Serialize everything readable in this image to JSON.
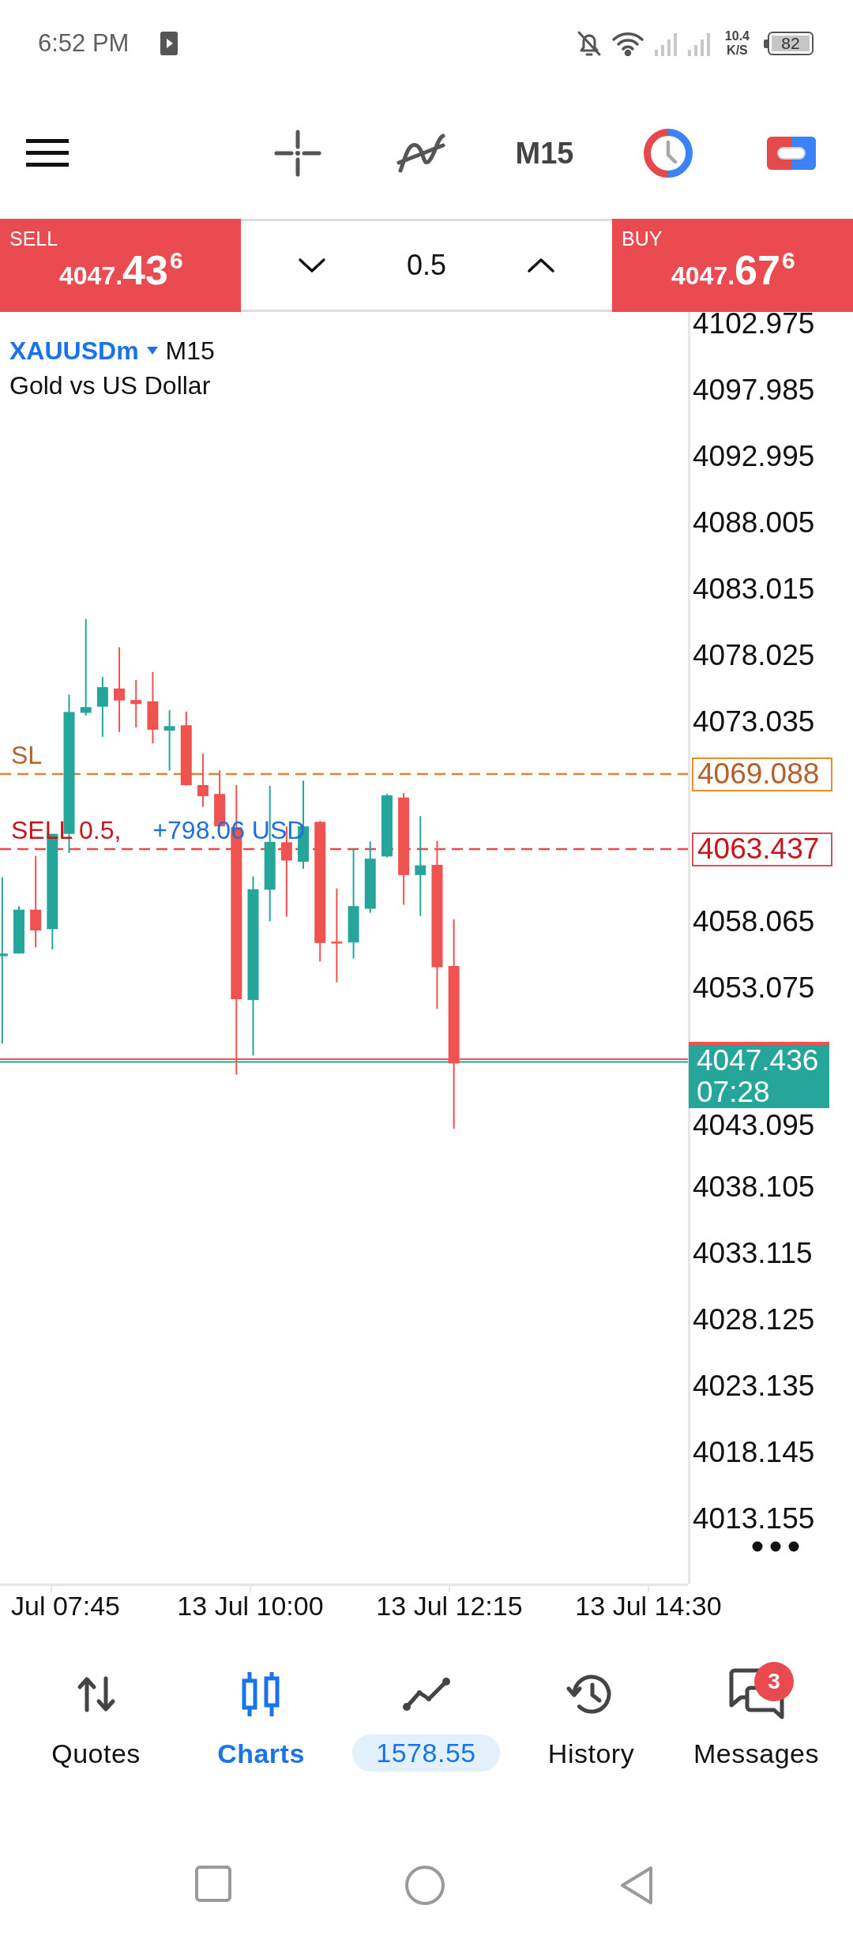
{
  "status_bar": {
    "time": "6:52 PM",
    "net_speed": "10.4",
    "net_speed_unit": "K/S",
    "battery": "82"
  },
  "toolbar": {
    "timeframe": "M15"
  },
  "trade_panel": {
    "sell": {
      "label": "SELL",
      "price_head": "4047.",
      "price_big": "43",
      "price_tail": "6"
    },
    "volume": "0.5",
    "buy": {
      "label": "BUY",
      "price_head": "4047.",
      "price_big": "67",
      "price_tail": "6"
    }
  },
  "chart": {
    "symbol": "XAUUSDm",
    "timeframe": "M15",
    "description": "Gold vs US Dollar",
    "levels": [
      {
        "kind": "stoploss",
        "label": "SL",
        "price": "4069.088"
      },
      {
        "kind": "order",
        "label": "SELL 0.5,",
        "profit": "+798.06 USD",
        "price": "4063.437"
      }
    ],
    "current_price": {
      "price": "4047.436",
      "countdown": "07:28"
    },
    "price_scale": [
      "4102.975",
      "4097.985",
      "4092.995",
      "4088.005",
      "4083.015",
      "4078.025",
      "4073.035",
      "4058.065",
      "4053.075",
      "4043.095",
      "4038.105",
      "4033.115",
      "4028.125",
      "4023.135",
      "4018.145",
      "4013.155"
    ],
    "time_scale": [
      "Jul 07:45",
      "13 Jul 10:00",
      "13 Jul 12:15",
      "13 Jul 14:30"
    ]
  },
  "nav": [
    {
      "kind": "tab",
      "label": "Quotes",
      "selected": false
    },
    {
      "kind": "tab",
      "label": "Charts",
      "selected": true
    },
    {
      "kind": "balance",
      "label": "1578.55",
      "selected": false
    },
    {
      "kind": "tab",
      "label": "History",
      "selected": false
    },
    {
      "kind": "tab",
      "label": "Messages",
      "selected": false,
      "badge": "3"
    }
  ]
}
